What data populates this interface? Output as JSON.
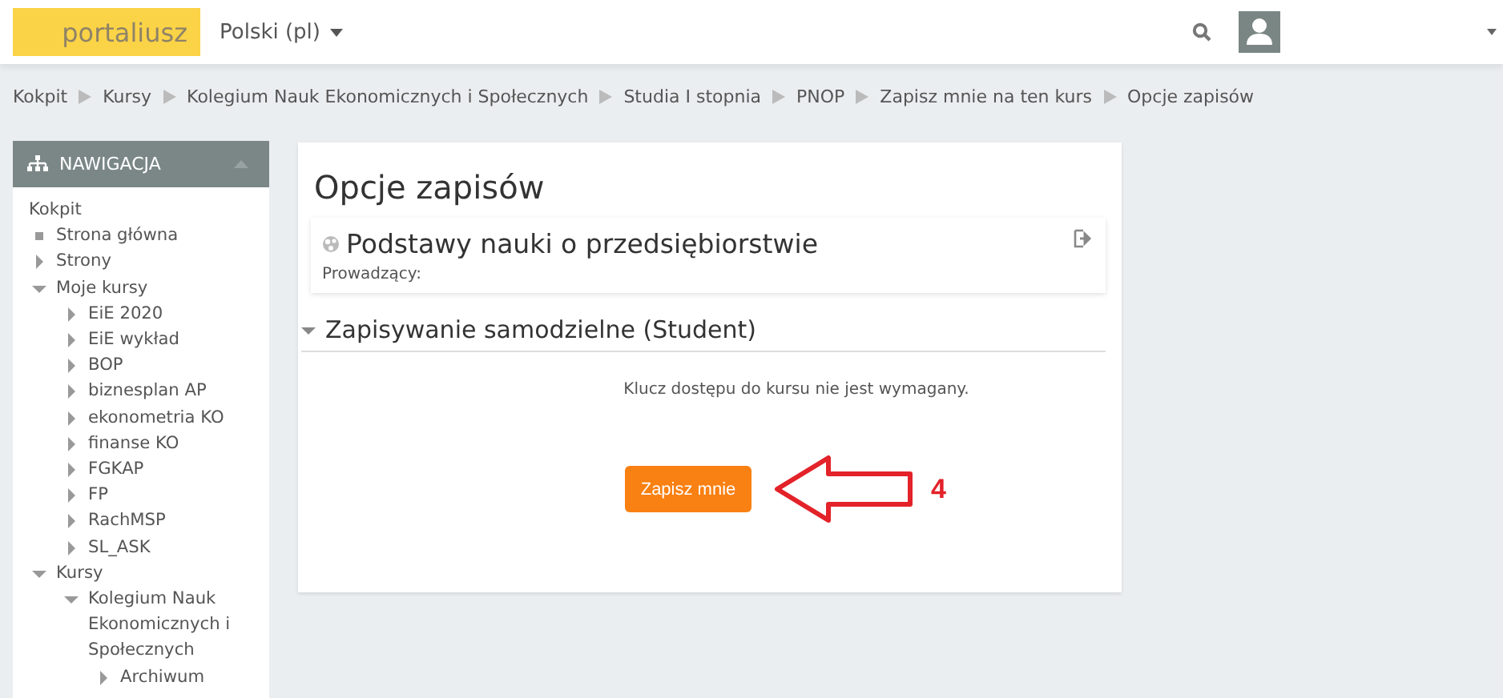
{
  "header": {
    "logo": "portaliusz",
    "language": "Polski (pl)"
  },
  "breadcrumbs": [
    "Kokpit",
    "Kursy",
    "Kolegium Nauk Ekonomicznych i Społecznych",
    "Studia I stopnia",
    "PNOP",
    "Zapisz mnie na ten kurs",
    "Opcje zapisów"
  ],
  "navigation": {
    "title": "NAWIGACJA",
    "items": [
      {
        "label": "Kokpit",
        "kind": "plain",
        "children": [
          {
            "label": "Strona główna",
            "kind": "leaf"
          },
          {
            "label": "Strony",
            "kind": "branch",
            "expanded": false
          },
          {
            "label": "Moje kursy",
            "kind": "branch",
            "expanded": true,
            "children": [
              {
                "label": "EiE 2020",
                "kind": "branch",
                "expanded": false
              },
              {
                "label": "EiE wykład",
                "kind": "branch",
                "expanded": false
              },
              {
                "label": "BOP",
                "kind": "branch",
                "expanded": false
              },
              {
                "label": "biznesplan AP",
                "kind": "branch",
                "expanded": false
              },
              {
                "label": "ekonometria KO",
                "kind": "branch",
                "expanded": false
              },
              {
                "label": "finanse KO",
                "kind": "branch",
                "expanded": false
              },
              {
                "label": "FGKAP",
                "kind": "branch",
                "expanded": false
              },
              {
                "label": "FP",
                "kind": "branch",
                "expanded": false
              },
              {
                "label": "RachMSP",
                "kind": "branch",
                "expanded": false
              },
              {
                "label": "SL_ASK",
                "kind": "branch",
                "expanded": false
              }
            ]
          },
          {
            "label": "Kursy",
            "kind": "branch",
            "expanded": true,
            "children": [
              {
                "label": "Kolegium Nauk Ekonomicznych i Społecznych",
                "kind": "branch",
                "expanded": true,
                "children": [
                  {
                    "label": "Archiwum",
                    "kind": "branch",
                    "expanded": false
                  }
                ]
              }
            ]
          }
        ]
      }
    ]
  },
  "main": {
    "title": "Opcje zapisów",
    "course": {
      "name": "Podstawy nauki o przedsiębiorstwie",
      "teacher_label": "Prowadzący:"
    },
    "section": {
      "title": "Zapisywanie samodzielne (Student)",
      "expanded": true,
      "message": "Klucz dostępu do kursu nie jest wymagany.",
      "button": "Zapisz mnie"
    },
    "annotation": "4"
  }
}
